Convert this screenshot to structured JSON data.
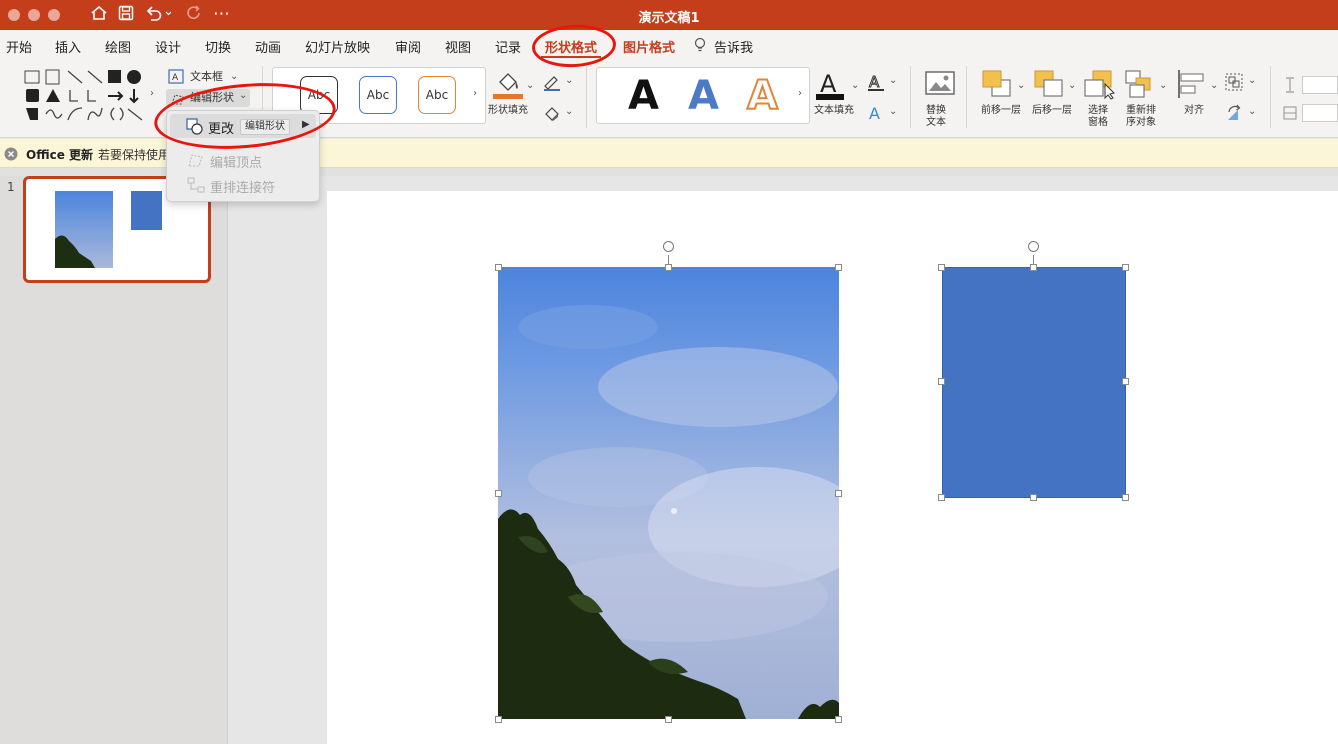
{
  "window": {
    "title": "演示文稿1"
  },
  "colors": {
    "accent": "#c43e1c",
    "shape_fill": "#4473c4",
    "notice_bg": "#fcf6d8",
    "annotation": "#e8170e"
  },
  "quick_access": {
    "icons": [
      "home-icon",
      "save-icon",
      "undo-icon",
      "redo-icon",
      "more-icon"
    ],
    "more": "⋯"
  },
  "tabs": [
    {
      "label": "开始"
    },
    {
      "label": "插入"
    },
    {
      "label": "绘图"
    },
    {
      "label": "设计"
    },
    {
      "label": "切换"
    },
    {
      "label": "动画"
    },
    {
      "label": "幻灯片放映"
    },
    {
      "label": "审阅"
    },
    {
      "label": "视图"
    },
    {
      "label": "记录"
    },
    {
      "label": "形状格式",
      "active": true
    },
    {
      "label": "图片格式",
      "contextual": true
    }
  ],
  "tell_me": "告诉我",
  "ribbon": {
    "textbox_label": "文本框",
    "edit_shape_label": "编辑形状",
    "shape_styles": [
      "Abc",
      "Abc",
      "Abc"
    ],
    "shape_fill_label": "形状填充",
    "wordart": [
      "A",
      "A",
      "A"
    ],
    "text_fill_label": "文本填充",
    "alt_text_label": "替换\n文本",
    "bring_forward": "前移一层",
    "send_backward": "后移一层",
    "selection_pane": "选择\n窗格",
    "reorder": "重新排\n序对象",
    "align": "对齐"
  },
  "edit_shape_menu": {
    "items": [
      {
        "label": "更改",
        "enabled": true
      },
      {
        "label": "编辑顶点",
        "enabled": false
      },
      {
        "label": "重排连接符",
        "enabled": false
      }
    ],
    "tooltip": "编辑形状"
  },
  "notice": {
    "title": "Office 更新",
    "text": "若要保持使用...，请选择“检查更新”。"
  },
  "slides": [
    {
      "number": "1"
    }
  ]
}
